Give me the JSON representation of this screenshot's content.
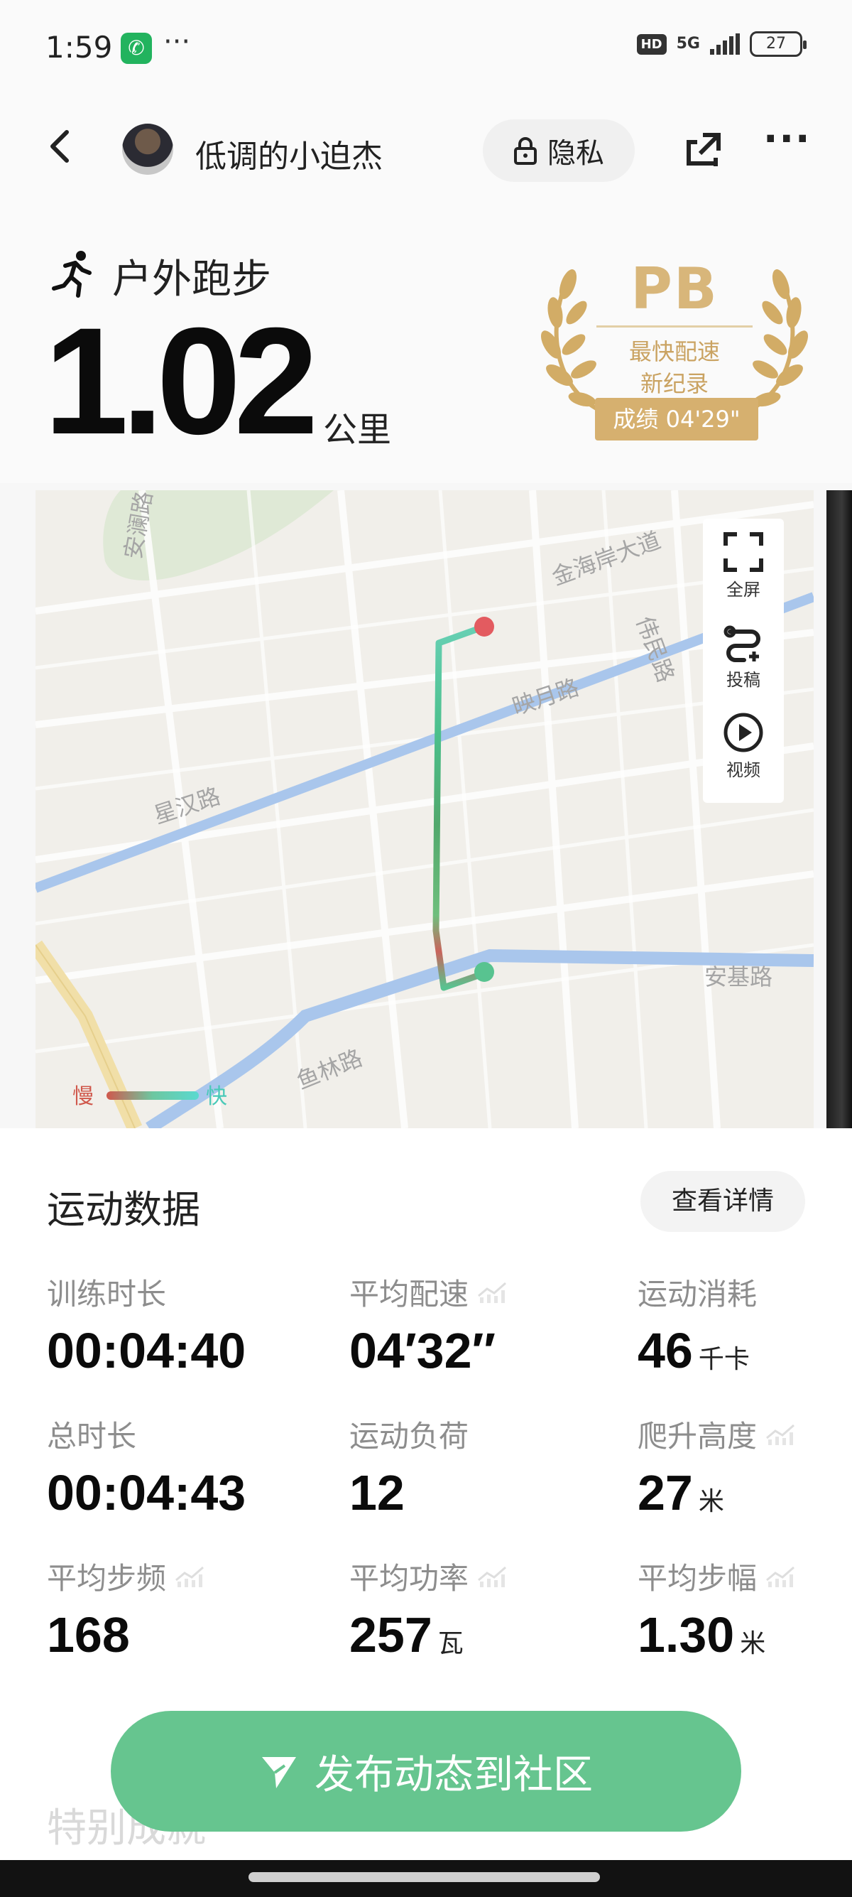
{
  "status_bar": {
    "time": "1:59",
    "dots": "···",
    "hd": "HD",
    "network": "5G",
    "battery": "27"
  },
  "header": {
    "username": "低调的小迫杰",
    "privacy_label": "隐私"
  },
  "summary": {
    "activity_type": "户外跑步",
    "distance": "1.02",
    "distance_unit": "公里",
    "pb": {
      "title": "PB",
      "line1": "最快配速",
      "line2": "新纪录",
      "score": "成绩 04'29\""
    }
  },
  "map": {
    "road_labels": [
      "安澜路",
      "金海岸大道",
      "伟民路",
      "映月路",
      "星汉路",
      "安基路",
      "鱼林路"
    ],
    "tools": [
      "全屏",
      "投稿",
      "视频"
    ],
    "speed_legend": {
      "slow": "慢",
      "fast": "快"
    }
  },
  "data_section": {
    "title": "运动数据",
    "details_button": "查看详情",
    "metrics": [
      {
        "label": "训练时长",
        "value": "00:04:40",
        "unit": "",
        "trend_icon": false
      },
      {
        "label": "平均配速",
        "value": "04′32″",
        "unit": "",
        "trend_icon": true
      },
      {
        "label": "运动消耗",
        "value": "46",
        "unit": "千卡",
        "trend_icon": false
      },
      {
        "label": "总时长",
        "value": "00:04:43",
        "unit": "",
        "trend_icon": false
      },
      {
        "label": "运动负荷",
        "value": "12",
        "unit": "",
        "trend_icon": false
      },
      {
        "label": "爬升高度",
        "value": "27",
        "unit": "米",
        "trend_icon": true
      },
      {
        "label": "平均步频",
        "value": "168",
        "unit": "",
        "trend_icon": true
      },
      {
        "label": "平均功率",
        "value": "257",
        "unit": "瓦",
        "trend_icon": true
      },
      {
        "label": "平均步幅",
        "value": "1.30",
        "unit": "米",
        "trend_icon": true
      }
    ],
    "special_title": "特别成就",
    "publish_button": "发布动态到社区"
  },
  "colors": {
    "accent_green": "#66c58f",
    "pb_gold": "#d6b06f",
    "route_start": "#5cc796",
    "route_end": "#e05a5f"
  }
}
